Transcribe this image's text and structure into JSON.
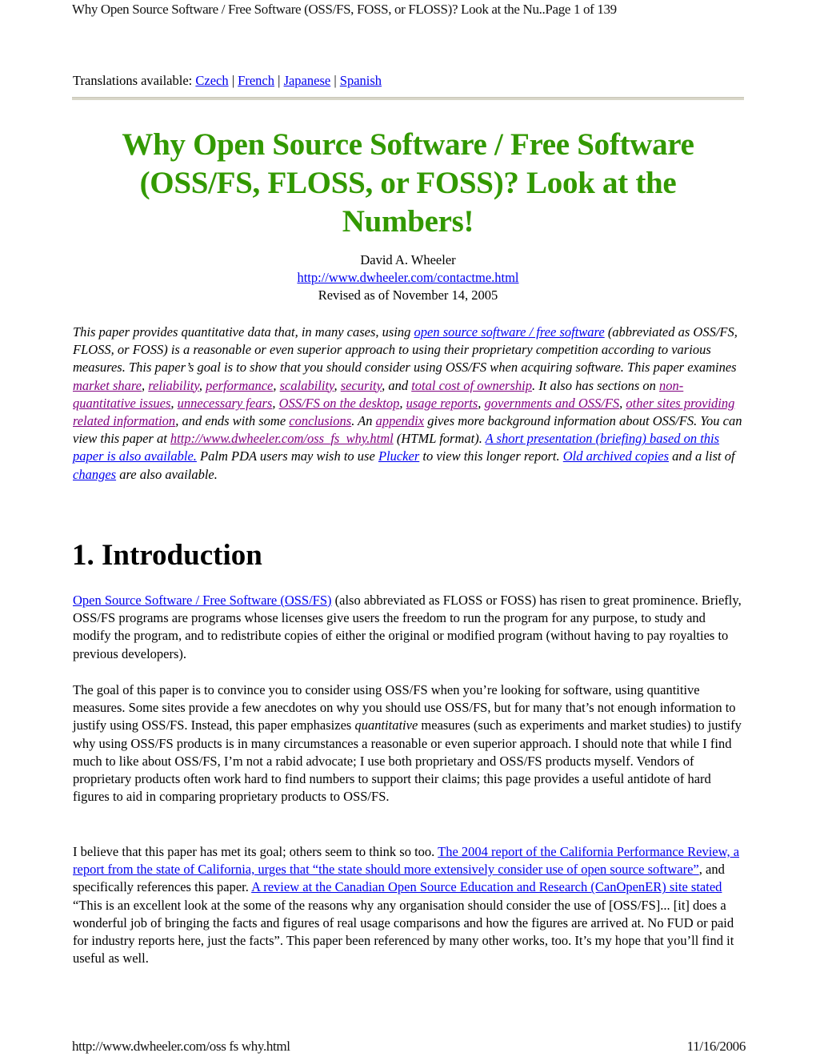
{
  "page_header": {
    "title": "Why Open Source Software / Free Software (OSS/FS, FOSS, or FLOSS)? Look at the Nu..",
    "page_indicator": "Page 1 of 139"
  },
  "translations": {
    "label": "Translations available:",
    "separator": "|",
    "links": [
      "Czech",
      "French",
      "Japanese",
      "Spanish"
    ]
  },
  "document": {
    "title": "Why Open Source Software / Free Software (OSS/FS, FLOSS, or FOSS)? Look at the Numbers!",
    "author": "David A. Wheeler",
    "contact_url": "http://www.dwheeler.com/contactme.html",
    "revised": "Revised as of November 14, 2005",
    "title_color": "#339900",
    "link_color": "#0000ee",
    "visited_link_color": "#800080"
  },
  "abstract": {
    "t1": "This paper provides quantitative data that, in many cases, using ",
    "l_oss": "open source software / free software",
    "t2": " (abbreviated as OSS/FS, FLOSS, or FOSS) is a reasonable or even superior approach to using their proprietary competition according to various measures. This paper’s goal is to show that you should consider using OSS/FS when acquiring software. This paper examines ",
    "l_market": "market share",
    "c1": ", ",
    "l_reliability": "reliability",
    "c2": ", ",
    "l_performance": "performance",
    "c3": ", ",
    "l_scalability": "scalability",
    "c4": ", ",
    "l_security": "security",
    "t3": ", and ",
    "l_tco": "total cost of ownership",
    "t4": ". It also has sections on ",
    "l_nonquant": "non-quantitative issues",
    "c5": ", ",
    "l_fears": "unnecessary fears",
    "c6": ", ",
    "l_desktop": "OSS/FS on the desktop",
    "c7": ", ",
    "l_usage": "usage reports",
    "c8": ", ",
    "l_gov": "governments and OSS/FS",
    "c9": ", ",
    "l_othersites": "other sites providing related information",
    "t5": ", and ends with some ",
    "l_conclusions": "conclusions",
    "t6": ". An ",
    "l_appendix": "appendix",
    "t7": " gives more background information about OSS/FS. You can view this paper at ",
    "l_url": "http://www.dwheeler.com/oss_fs_why.html",
    "t8": " (HTML format). ",
    "l_presentation": "A short presentation (briefing) based on this paper is also available.",
    "t9": " Palm PDA users may wish to use ",
    "l_plucker": "Plucker",
    "t10": " to view this longer report. ",
    "l_archived": "Old archived copies",
    "t11": " and a list of ",
    "l_changes": "changes",
    "t12": " are also available."
  },
  "section1": {
    "heading": "1. Introduction",
    "p1": {
      "link": "Open Source Software / Free Software (OSS/FS)",
      "text": " (also abbreviated as FLOSS or FOSS) has risen to great prominence. Briefly, OSS/FS programs are programs whose licenses give users the freedom to run the program for any purpose, to study and modify the program, and to redistribute copies of either the original or modified program (without having to pay royalties to previous developers)."
    },
    "p2": {
      "t1": "The goal of this paper is to convince you to consider using OSS/FS when you’re looking for software, using quantitive measures. Some sites provide a few anecdotes on why you should use OSS/FS, but for many that’s not enough information to justify using OSS/FS. Instead, this paper emphasizes ",
      "em": "quantitative",
      "t2": " measures (such as experiments and market studies) to justify why using OSS/FS products is in many circumstances a reasonable or even superior approach. I should note that while I find much to like about OSS/FS, I’m not a rabid advocate; I use both proprietary and OSS/FS products myself. Vendors of proprietary products often work hard to find numbers to support their claims; this page provides a useful antidote of hard figures to aid in comparing proprietary products to OSS/FS."
    },
    "p3": {
      "t1": "I believe that this paper has met its goal; others seem to think so too. ",
      "l_california": "The 2004 report of the California Performance Review, a report from the state of California, urges that “the state should more extensively consider use of open source software”",
      "t2": ", and specifically references this paper. ",
      "l_canopener": "A review at the Canadian Open Source Education and Research (CanOpenER) site stated ",
      "t3": "“This is an excellent look at the some of the reasons why any organisation should consider the use of [OSS/FS]... [it] does a wonderful job of bringing the facts and figures of real usage comparisons and how the figures are arrived at. No FUD or paid for industry reports here, just the facts”. This paper been referenced by many other works, too. It’s my hope that you’ll find it useful as well."
    }
  },
  "page_footer": {
    "url": "http://www.dwheeler.com/oss_fs_why.html",
    "date": "11/16/2006"
  }
}
